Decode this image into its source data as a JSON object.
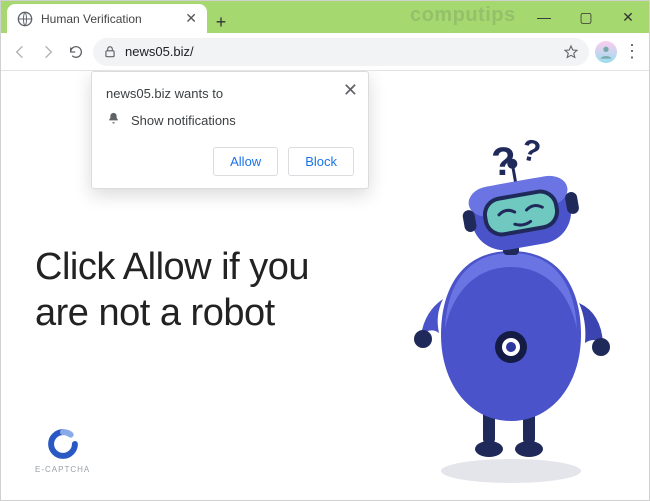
{
  "window": {
    "watermark": "computips",
    "minimize": "—",
    "maximize": "▢",
    "close": "✕"
  },
  "tab": {
    "title": "Human Verification",
    "close_glyph": "✕",
    "new_tab_glyph": "+"
  },
  "nav": {
    "url": "news05.biz/",
    "menu_glyph": "⋮"
  },
  "notification": {
    "title_prefix": "news05.biz wants to",
    "permission_label": "Show notifications",
    "allow_label": "Allow",
    "block_label": "Block",
    "close_glyph": "✕"
  },
  "page": {
    "headline": "Click Allow if you are not a robot",
    "ecaptcha_label": "E-CAPTCHA",
    "question_glyph": "?"
  }
}
